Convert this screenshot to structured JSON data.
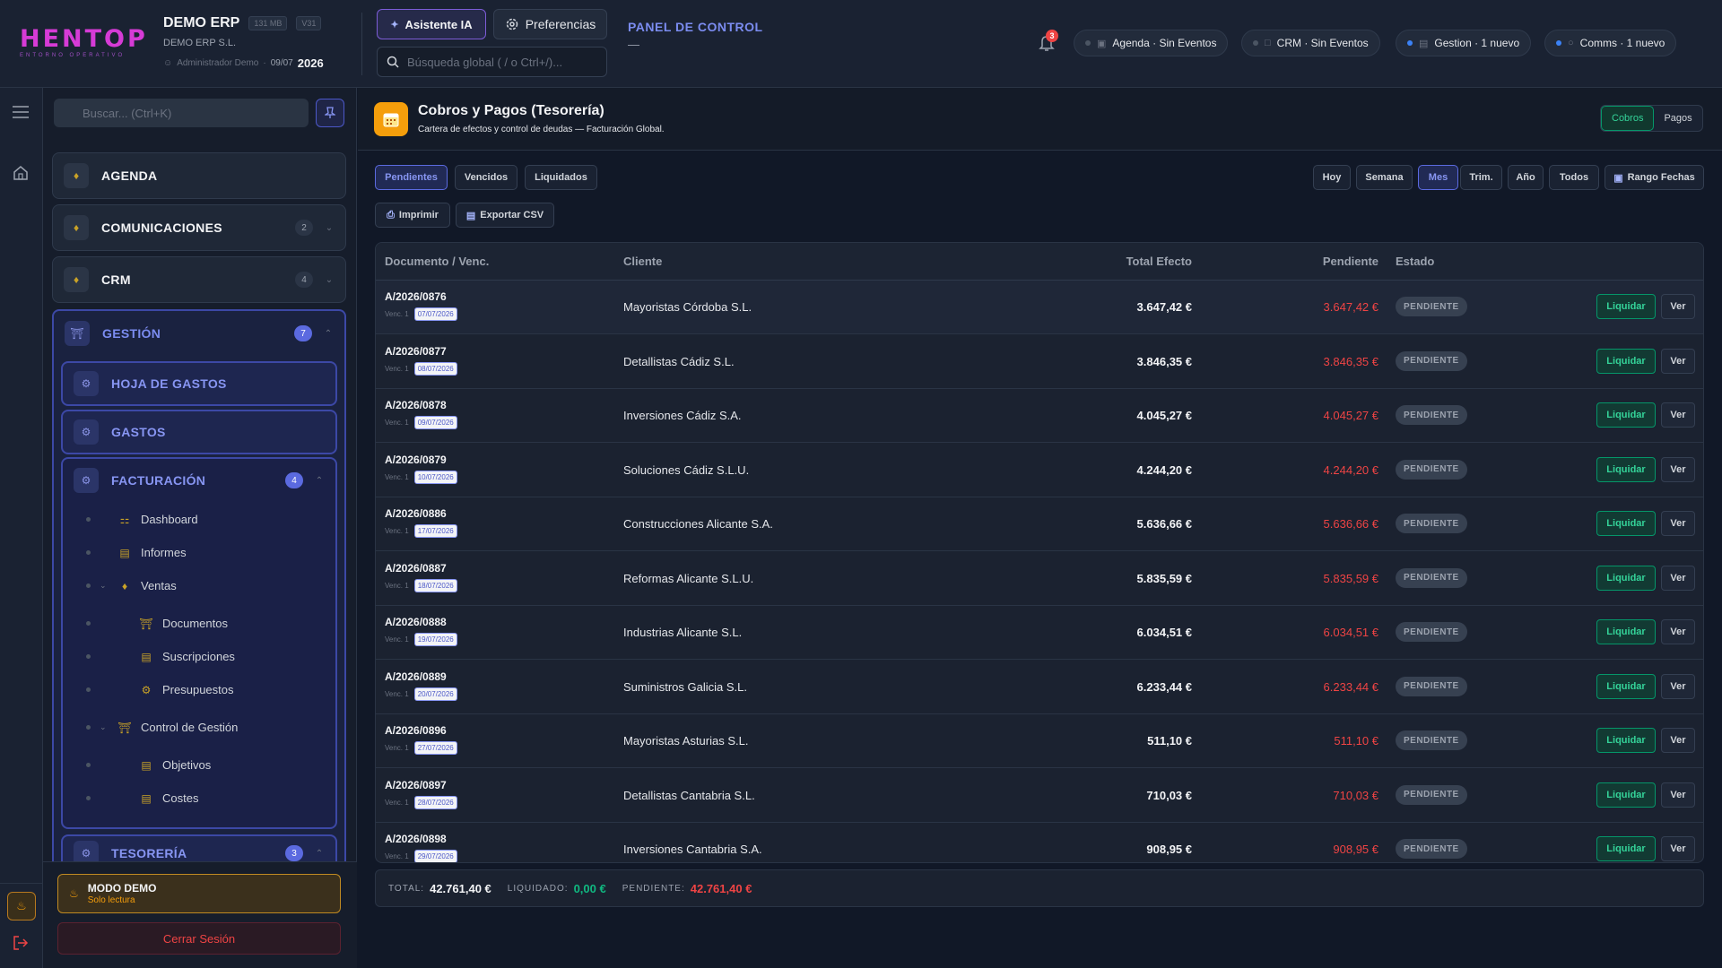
{
  "header": {
    "logo": "HENTOP",
    "logo_sub": "ENTORNO OPERATIVO",
    "company": "DEMO ERP",
    "size_chip": "131 MB",
    "version_chip": "V31",
    "company_legal": "DEMO ERP S.L.",
    "user": "Administrador Demo",
    "date": "09/07",
    "year": "2026",
    "ai_label": "Asistente IA",
    "prefs_label": "Preferencias",
    "search_placeholder": "Búsqueda global ( / o Ctrl+/)...",
    "panel_title": "PANEL DE CONTROL",
    "panel_dash": "—",
    "bell_count": "3",
    "pills": [
      {
        "label": "Agenda · Sin Eventos"
      },
      {
        "label": "CRM · Sin Eventos"
      },
      {
        "label": "Gestion · 1 nuevo"
      },
      {
        "label": "Comms · 1 nuevo"
      }
    ]
  },
  "sidebar": {
    "search_placeholder": "Buscar... (Ctrl+K)",
    "items": [
      {
        "label": "AGENDA"
      },
      {
        "label": "COMUNICACIONES",
        "count": "2"
      },
      {
        "label": "CRM",
        "count": "4"
      }
    ],
    "gestion": {
      "label": "GESTIÓN",
      "count": "7",
      "sub": [
        {
          "label": "HOJA DE GASTOS"
        },
        {
          "label": "GASTOS"
        }
      ],
      "facturacion": {
        "label": "FACTURACIÓN",
        "count": "4",
        "leaves": [
          {
            "label": "Dashboard"
          },
          {
            "label": "Informes"
          },
          {
            "label": "Ventas"
          },
          {
            "label": "Documentos"
          },
          {
            "label": "Suscripciones"
          },
          {
            "label": "Presupuestos"
          },
          {
            "label": "Control de Gestión"
          },
          {
            "label": "Objetivos"
          },
          {
            "label": "Costes"
          }
        ]
      },
      "tesoreria": {
        "label": "TESORERÍA",
        "count": "3"
      }
    },
    "demo_title": "MODO DEMO",
    "demo_sub": "Solo lectura",
    "logout": "Cerrar Sesión"
  },
  "main": {
    "title": "Cobros y Pagos (Tesorería)",
    "subtitle": "Cartera de efectos y control de deudas — Facturación Global.",
    "toggle": {
      "cobros": "Cobros",
      "pagos": "Pagos"
    },
    "tabs": {
      "pendientes": "Pendientes",
      "vencidos": "Vencidos",
      "liquidados": "Liquidados"
    },
    "periods": {
      "hoy": "Hoy",
      "semana": "Semana",
      "mes": "Mes",
      "trim": "Trim.",
      "anio": "Año",
      "todos": "Todos",
      "rango": "Rango Fechas"
    },
    "print": "Imprimir",
    "export": "Exportar CSV",
    "columns": {
      "doc": "Documento / Venc.",
      "client": "Cliente",
      "total": "Total Efecto",
      "pending": "Pendiente",
      "status": "Estado"
    },
    "venc_label": "Venc. 1",
    "liquidar": "Liquidar",
    "ver": "Ver",
    "rows": [
      {
        "doc": "A/2026/0876",
        "date": "07/07/2026",
        "client": "Mayoristas Córdoba S.L.",
        "total": "3.647,42 €",
        "pending": "3.647,42 €",
        "status": "PENDIENTE"
      },
      {
        "doc": "A/2026/0877",
        "date": "08/07/2026",
        "client": "Detallistas Cádiz S.L.",
        "total": "3.846,35 €",
        "pending": "3.846,35 €",
        "status": "PENDIENTE"
      },
      {
        "doc": "A/2026/0878",
        "date": "09/07/2026",
        "client": "Inversiones Cádiz S.A.",
        "total": "4.045,27 €",
        "pending": "4.045,27 €",
        "status": "PENDIENTE"
      },
      {
        "doc": "A/2026/0879",
        "date": "10/07/2026",
        "client": "Soluciones Cádiz S.L.U.",
        "total": "4.244,20 €",
        "pending": "4.244,20 €",
        "status": "PENDIENTE"
      },
      {
        "doc": "A/2026/0886",
        "date": "17/07/2026",
        "client": "Construcciones Alicante S.A.",
        "total": "5.636,66 €",
        "pending": "5.636,66 €",
        "status": "PENDIENTE"
      },
      {
        "doc": "A/2026/0887",
        "date": "18/07/2026",
        "client": "Reformas Alicante S.L.U.",
        "total": "5.835,59 €",
        "pending": "5.835,59 €",
        "status": "PENDIENTE"
      },
      {
        "doc": "A/2026/0888",
        "date": "19/07/2026",
        "client": "Industrias Alicante S.L.",
        "total": "6.034,51 €",
        "pending": "6.034,51 €",
        "status": "PENDIENTE"
      },
      {
        "doc": "A/2026/0889",
        "date": "20/07/2026",
        "client": "Suministros Galicia S.L.",
        "total": "6.233,44 €",
        "pending": "6.233,44 €",
        "status": "PENDIENTE"
      },
      {
        "doc": "A/2026/0896",
        "date": "27/07/2026",
        "client": "Mayoristas Asturias S.L.",
        "total": "511,10 €",
        "pending": "511,10 €",
        "status": "PENDIENTE"
      },
      {
        "doc": "A/2026/0897",
        "date": "28/07/2026",
        "client": "Detallistas Cantabria S.L.",
        "total": "710,03 €",
        "pending": "710,03 €",
        "status": "PENDIENTE"
      },
      {
        "doc": "A/2026/0898",
        "date": "29/07/2026",
        "client": "Inversiones Cantabria S.A.",
        "total": "908,95 €",
        "pending": "908,95 €",
        "status": "PENDIENTE"
      }
    ],
    "totals": {
      "total_label": "TOTAL:",
      "total": "42.761,40 €",
      "liq_label": "LIQUIDADO:",
      "liq": "0,00 €",
      "pend_label": "PENDIENTE:",
      "pend": "42.761,40 €"
    }
  }
}
